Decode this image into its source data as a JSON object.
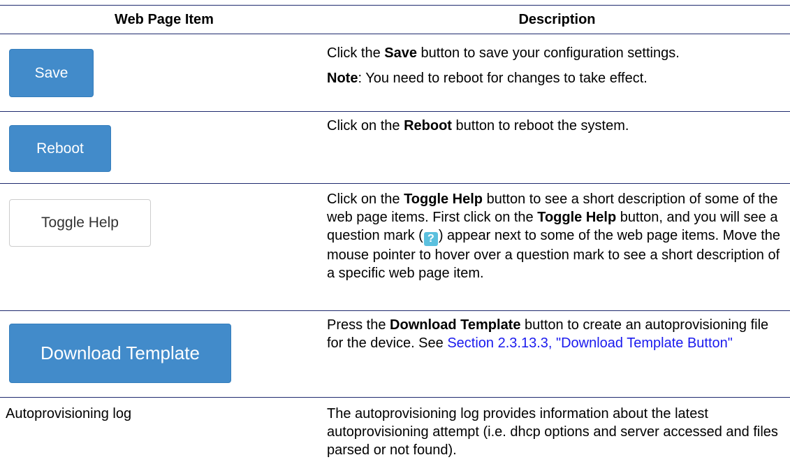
{
  "table": {
    "headers": {
      "item": "Web Page Item",
      "description": "Description"
    },
    "rows": [
      {
        "item": "Save",
        "desc": {
          "p1_pre": "Click the ",
          "p1_bold": "Save",
          "p1_post": " button to save your configuration settings.",
          "p2_bold": "Note",
          "p2_post": ": You need to reboot for changes to take effect."
        }
      },
      {
        "item": "Reboot",
        "desc": {
          "pre": "Click on the ",
          "bold": "Reboot",
          "post": " button to reboot the system."
        }
      },
      {
        "item": "Toggle Help",
        "desc": {
          "pre": "Click on the ",
          "bold1": "Toggle Help",
          "mid": " button to see a short description of some of the web page items. First click on the ",
          "bold2": "Toggle Help",
          "mid2": " button, and you will see a question mark (",
          "qmark": "?",
          "post": ") appear next to some of the web page items. Move the mouse pointer to hover over a question mark to see a short description of a specific web page item."
        }
      },
      {
        "item": "Download Template",
        "desc": {
          "pre": "Press the ",
          "bold": "Download Template",
          "mid": " button to create an autoprovisioning file for the device. See ",
          "link": "Section 2.3.13.3, \"Download Template Button\""
        }
      },
      {
        "item": "Autoprovisioning log",
        "desc": {
          "text": "The autoprovisioning log provides information about the latest autoprovisioning attempt (i.e. dhcp options and server accessed and files parsed or not found)."
        }
      }
    ]
  },
  "colors": {
    "primary_button": "#428bca",
    "default_button_border": "#cccccc",
    "rule_line": "#1f2a6e",
    "link": "#1a1aee",
    "help_icon": "#5bc0de"
  }
}
